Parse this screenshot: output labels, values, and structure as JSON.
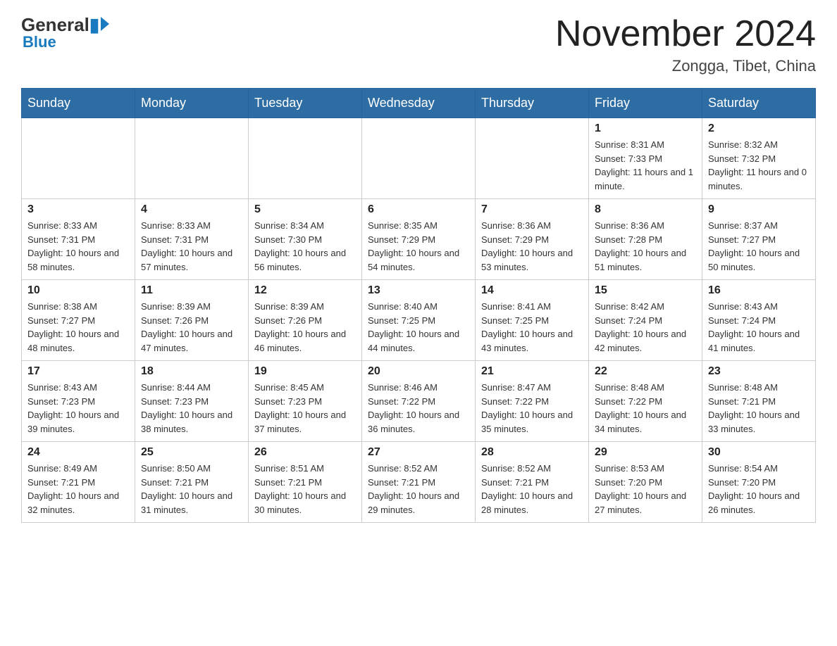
{
  "header": {
    "logo_general": "General",
    "logo_blue": "Blue",
    "month_title": "November 2024",
    "location": "Zongga, Tibet, China"
  },
  "days_of_week": [
    "Sunday",
    "Monday",
    "Tuesday",
    "Wednesday",
    "Thursday",
    "Friday",
    "Saturday"
  ],
  "weeks": [
    {
      "cells": [
        {
          "day": "",
          "info": ""
        },
        {
          "day": "",
          "info": ""
        },
        {
          "day": "",
          "info": ""
        },
        {
          "day": "",
          "info": ""
        },
        {
          "day": "",
          "info": ""
        },
        {
          "day": "1",
          "info": "Sunrise: 8:31 AM\nSunset: 7:33 PM\nDaylight: 11 hours and 1 minute."
        },
        {
          "day": "2",
          "info": "Sunrise: 8:32 AM\nSunset: 7:32 PM\nDaylight: 11 hours and 0 minutes."
        }
      ]
    },
    {
      "cells": [
        {
          "day": "3",
          "info": "Sunrise: 8:33 AM\nSunset: 7:31 PM\nDaylight: 10 hours and 58 minutes."
        },
        {
          "day": "4",
          "info": "Sunrise: 8:33 AM\nSunset: 7:31 PM\nDaylight: 10 hours and 57 minutes."
        },
        {
          "day": "5",
          "info": "Sunrise: 8:34 AM\nSunset: 7:30 PM\nDaylight: 10 hours and 56 minutes."
        },
        {
          "day": "6",
          "info": "Sunrise: 8:35 AM\nSunset: 7:29 PM\nDaylight: 10 hours and 54 minutes."
        },
        {
          "day": "7",
          "info": "Sunrise: 8:36 AM\nSunset: 7:29 PM\nDaylight: 10 hours and 53 minutes."
        },
        {
          "day": "8",
          "info": "Sunrise: 8:36 AM\nSunset: 7:28 PM\nDaylight: 10 hours and 51 minutes."
        },
        {
          "day": "9",
          "info": "Sunrise: 8:37 AM\nSunset: 7:27 PM\nDaylight: 10 hours and 50 minutes."
        }
      ]
    },
    {
      "cells": [
        {
          "day": "10",
          "info": "Sunrise: 8:38 AM\nSunset: 7:27 PM\nDaylight: 10 hours and 48 minutes."
        },
        {
          "day": "11",
          "info": "Sunrise: 8:39 AM\nSunset: 7:26 PM\nDaylight: 10 hours and 47 minutes."
        },
        {
          "day": "12",
          "info": "Sunrise: 8:39 AM\nSunset: 7:26 PM\nDaylight: 10 hours and 46 minutes."
        },
        {
          "day": "13",
          "info": "Sunrise: 8:40 AM\nSunset: 7:25 PM\nDaylight: 10 hours and 44 minutes."
        },
        {
          "day": "14",
          "info": "Sunrise: 8:41 AM\nSunset: 7:25 PM\nDaylight: 10 hours and 43 minutes."
        },
        {
          "day": "15",
          "info": "Sunrise: 8:42 AM\nSunset: 7:24 PM\nDaylight: 10 hours and 42 minutes."
        },
        {
          "day": "16",
          "info": "Sunrise: 8:43 AM\nSunset: 7:24 PM\nDaylight: 10 hours and 41 minutes."
        }
      ]
    },
    {
      "cells": [
        {
          "day": "17",
          "info": "Sunrise: 8:43 AM\nSunset: 7:23 PM\nDaylight: 10 hours and 39 minutes."
        },
        {
          "day": "18",
          "info": "Sunrise: 8:44 AM\nSunset: 7:23 PM\nDaylight: 10 hours and 38 minutes."
        },
        {
          "day": "19",
          "info": "Sunrise: 8:45 AM\nSunset: 7:23 PM\nDaylight: 10 hours and 37 minutes."
        },
        {
          "day": "20",
          "info": "Sunrise: 8:46 AM\nSunset: 7:22 PM\nDaylight: 10 hours and 36 minutes."
        },
        {
          "day": "21",
          "info": "Sunrise: 8:47 AM\nSunset: 7:22 PM\nDaylight: 10 hours and 35 minutes."
        },
        {
          "day": "22",
          "info": "Sunrise: 8:48 AM\nSunset: 7:22 PM\nDaylight: 10 hours and 34 minutes."
        },
        {
          "day": "23",
          "info": "Sunrise: 8:48 AM\nSunset: 7:21 PM\nDaylight: 10 hours and 33 minutes."
        }
      ]
    },
    {
      "cells": [
        {
          "day": "24",
          "info": "Sunrise: 8:49 AM\nSunset: 7:21 PM\nDaylight: 10 hours and 32 minutes."
        },
        {
          "day": "25",
          "info": "Sunrise: 8:50 AM\nSunset: 7:21 PM\nDaylight: 10 hours and 31 minutes."
        },
        {
          "day": "26",
          "info": "Sunrise: 8:51 AM\nSunset: 7:21 PM\nDaylight: 10 hours and 30 minutes."
        },
        {
          "day": "27",
          "info": "Sunrise: 8:52 AM\nSunset: 7:21 PM\nDaylight: 10 hours and 29 minutes."
        },
        {
          "day": "28",
          "info": "Sunrise: 8:52 AM\nSunset: 7:21 PM\nDaylight: 10 hours and 28 minutes."
        },
        {
          "day": "29",
          "info": "Sunrise: 8:53 AM\nSunset: 7:20 PM\nDaylight: 10 hours and 27 minutes."
        },
        {
          "day": "30",
          "info": "Sunrise: 8:54 AM\nSunset: 7:20 PM\nDaylight: 10 hours and 26 minutes."
        }
      ]
    }
  ]
}
